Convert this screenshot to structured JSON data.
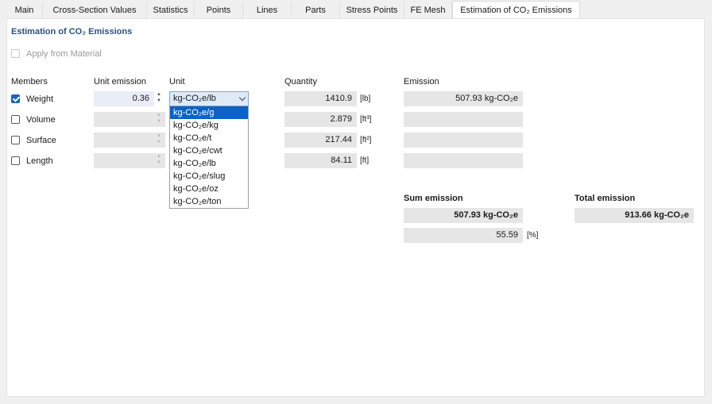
{
  "tabs": [
    {
      "label": "Main"
    },
    {
      "label": "Cross-Section Values"
    },
    {
      "label": "Statistics"
    },
    {
      "label": "Points"
    },
    {
      "label": "Lines"
    },
    {
      "label": "Parts"
    },
    {
      "label": "Stress Points"
    },
    {
      "label": "FE Mesh"
    },
    {
      "label": "Estimation of CO₂ Emissions"
    }
  ],
  "active_tab_index": 8,
  "section": {
    "title": "Estimation of CO₂ Emissions",
    "apply_from_material": {
      "label": "Apply from Material",
      "checked": false,
      "enabled": false
    }
  },
  "headers": {
    "members": "Members",
    "unit_emission": "Unit emission",
    "unit": "Unit",
    "quantity": "Quantity",
    "emission": "Emission"
  },
  "rows": [
    {
      "label": "Weight",
      "checked": true,
      "unit_emission": "0.36",
      "unit": "kg-CO₂e/lb",
      "quantity": "1410.9",
      "quantity_unit": "[lb]",
      "emission": "507.93 kg-CO₂e"
    },
    {
      "label": "Volume",
      "checked": false,
      "unit_emission": "",
      "unit": "",
      "quantity": "2.879",
      "quantity_unit": "[ft³]",
      "emission": ""
    },
    {
      "label": "Surface",
      "checked": false,
      "unit_emission": "",
      "unit": "",
      "quantity": "217.44",
      "quantity_unit": "[ft²]",
      "emission": ""
    },
    {
      "label": "Length",
      "checked": false,
      "unit_emission": "",
      "unit": "",
      "quantity": "84.11",
      "quantity_unit": "[ft]",
      "emission": ""
    }
  ],
  "unit_dropdown": {
    "selected": "kg-CO₂e/lb",
    "highlighted_index": 0,
    "options": [
      "kg-CO₂e/g",
      "kg-CO₂e/kg",
      "kg-CO₂e/t",
      "kg-CO₂e/cwt",
      "kg-CO₂e/lb",
      "kg-CO₂e/slug",
      "kg-CO₂e/oz",
      "kg-CO₂e/ton"
    ]
  },
  "sum_emission": {
    "label": "Sum emission",
    "value": "507.93 kg-CO₂e",
    "percent": "55.59",
    "percent_unit": "[%]"
  },
  "total_emission": {
    "label": "Total emission",
    "value": "913.66 kg-CO₂e"
  },
  "colors": {
    "section_title": "#2d4f80",
    "accent": "#0a64c8",
    "field_bg": "#e6e6e6",
    "checkbox_checked": "#1565c0"
  }
}
